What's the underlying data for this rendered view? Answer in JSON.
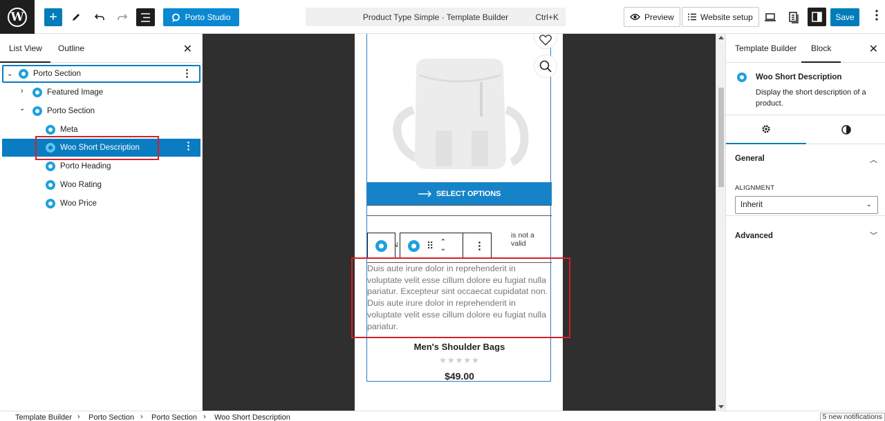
{
  "topbar": {
    "studio_label": "Porto Studio",
    "command_title": "Product Type Simple · Template Builder",
    "command_shortcut": "Ctrl+K",
    "preview_label": "Preview",
    "website_setup_label": "Website setup",
    "save_label": "Save"
  },
  "left_panel": {
    "tabs": [
      "List View",
      "Outline"
    ],
    "active_tab": "List View",
    "tree": [
      {
        "label": "Porto Section",
        "level": 0,
        "expanded": true
      },
      {
        "label": "Featured Image",
        "level": 1,
        "expanded": false
      },
      {
        "label": "Porto Section",
        "level": 1,
        "expanded": true
      },
      {
        "label": "Meta",
        "level": 2
      },
      {
        "label": "Woo Short Description",
        "level": 2,
        "selected": true
      },
      {
        "label": "Porto Heading",
        "level": 2
      },
      {
        "label": "Woo Rating",
        "level": 2
      },
      {
        "label": "Woo Price",
        "level": 2
      }
    ]
  },
  "canvas": {
    "select_options_label": "SELECT OPTIONS",
    "meta_text": "is not a valid",
    "meta_fragment_1": "r",
    "meta_fragment_2": "N",
    "short_description": "Duis aute irure dolor in reprehenderit in voluptate velit esse cillum dolore eu fugiat nulla pariatur. Excepteur sint occaecat cupidatat non. Duis aute irure dolor in reprehenderit in voluptate velit esse cillum dolore eu fugiat nulla pariatur.",
    "product_title": "Men's Shoulder Bags",
    "rating": 0,
    "stars": "★★★★★",
    "price": "$49.00"
  },
  "right_panel": {
    "tabs": [
      "Template Builder",
      "Block"
    ],
    "active_tab": "Block",
    "block_name": "Woo Short Description",
    "block_description": "Display the short description of a product.",
    "general_label": "General",
    "alignment_label": "ALIGNMENT",
    "alignment_value": "Inherit",
    "advanced_label": "Advanced"
  },
  "footer": {
    "breadcrumbs": [
      "Template Builder",
      "Porto Section",
      "Porto Section",
      "Woo Short Description"
    ],
    "notifications": "5 new notifications"
  },
  "colors": {
    "accent": "#007cba",
    "selection": "#0a7cc1",
    "porto_icon": "#1da1dc",
    "highlight_box": "#d61f28"
  }
}
